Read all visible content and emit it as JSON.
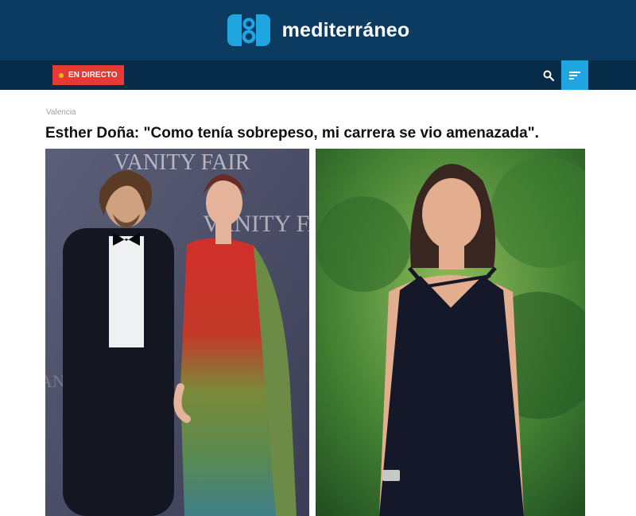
{
  "header": {
    "brand_name": "mediterráneo",
    "logo_icon": "number-eight-logo-icon",
    "brand_color": "#1fa6e0",
    "background_color": "#0b3b60"
  },
  "nav": {
    "live_label": "EN DIRECTO",
    "live_color": "#e53a35",
    "search_icon": "search-icon",
    "menu_icon": "menu-lines-icon",
    "background_color": "#072c4a"
  },
  "article": {
    "category": "Valencia",
    "headline": "Esther Doña: \"Como tenía sobrepeso, mi carrera se vio amenazada\".",
    "photo_left_backdrop_text_1": "VANITY FAIR",
    "photo_left_backdrop_text_2": "VANITY FAIR",
    "photo_left_backdrop_text_3": "VANITY FAIR"
  }
}
